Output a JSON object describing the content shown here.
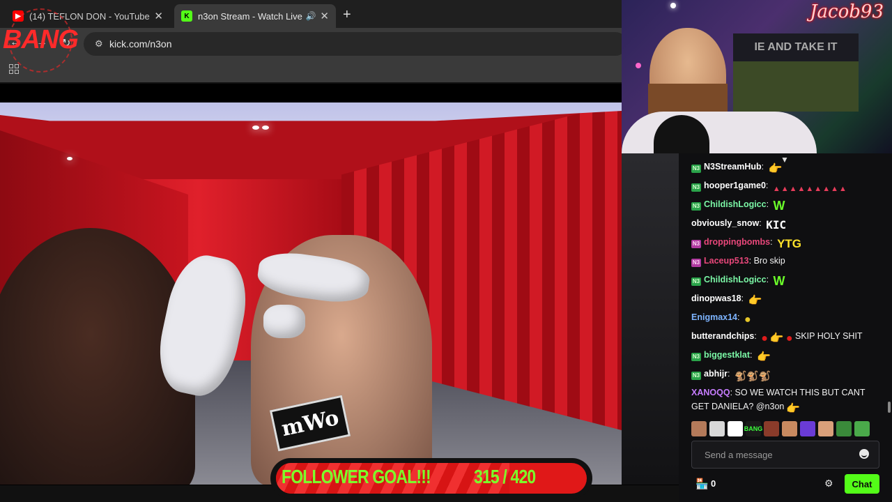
{
  "browser": {
    "tabs": [
      {
        "title": "(14) TEFLON DON - YouTube",
        "favicon": "youtube-icon",
        "active": false
      },
      {
        "title": "n3on Stream - Watch Live o",
        "favicon": "kick-icon",
        "active": true
      }
    ],
    "url": "kick.com/n3on",
    "new_tab": "+",
    "close": "✕"
  },
  "overlay": {
    "bang_logo": "BANG",
    "webcam_name": "Jacob93",
    "webcam_flag_text": "IE AND TAKE IT",
    "ring_sign": "mWo"
  },
  "follower_goal": {
    "label": "FOLLOWER GOAL!!!",
    "count": "315 / 420",
    "current": 315,
    "target": 420
  },
  "chat": {
    "messages": [
      {
        "user": "N3StreamHub",
        "color": "#ffffff",
        "badge": "green",
        "text": "",
        "emote": "hand"
      },
      {
        "user": "hooper1game0",
        "color": "#ffffff",
        "badge": "green",
        "text": "",
        "emote": "cakes"
      },
      {
        "user": "ChildishLogicc",
        "color": "#7bf7a6",
        "badge": "green",
        "text": "",
        "emote": "W"
      },
      {
        "user": "obviously_snow",
        "color": "#ffffff",
        "badge": "none",
        "text": "",
        "emote": "KIC"
      },
      {
        "user": "droppingbombs",
        "color": "#e8477a",
        "badge": "pink",
        "text": "",
        "emote": "YTG"
      },
      {
        "user": "Laceup513",
        "color": "#e8477a",
        "badge": "pink",
        "text": "Bro skip",
        "emote": ""
      },
      {
        "user": "ChildishLogicc",
        "color": "#7bf7a6",
        "badge": "green",
        "text": "",
        "emote": "W"
      },
      {
        "user": "dinopwas18",
        "color": "#ffffff",
        "badge": "none",
        "text": "",
        "emote": "hand"
      },
      {
        "user": "Enigmax14",
        "color": "#7db4ff",
        "badge": "none",
        "text": "",
        "emote": "yellow"
      },
      {
        "user": "butterandchips",
        "color": "#ffffff",
        "badge": "none",
        "text": "SKIP HOLY SHIT",
        "emote": "mixed"
      },
      {
        "user": "biggestklat",
        "color": "#7bf7a6",
        "badge": "green",
        "text": "",
        "emote": "hand"
      },
      {
        "user": "abhijr",
        "color": "#ffffff",
        "badge": "green",
        "text": "",
        "emote": "monkeys"
      },
      {
        "user": "XANOQQ",
        "color": "#c77dff",
        "badge": "none",
        "text": "SO WE WATCH THIS BUT CANT GET DANIELA? @n3on",
        "emote": "hand"
      }
    ],
    "emote_bar": [
      "",
      "",
      "",
      "BANG",
      "",
      "",
      "",
      "",
      "",
      ""
    ],
    "input_placeholder": "Send a message",
    "points": "0",
    "chat_button": "Chat"
  },
  "colors": {
    "kick_green": "#53fc18",
    "goal_red": "#e01818",
    "goal_text": "#7cff2a"
  }
}
